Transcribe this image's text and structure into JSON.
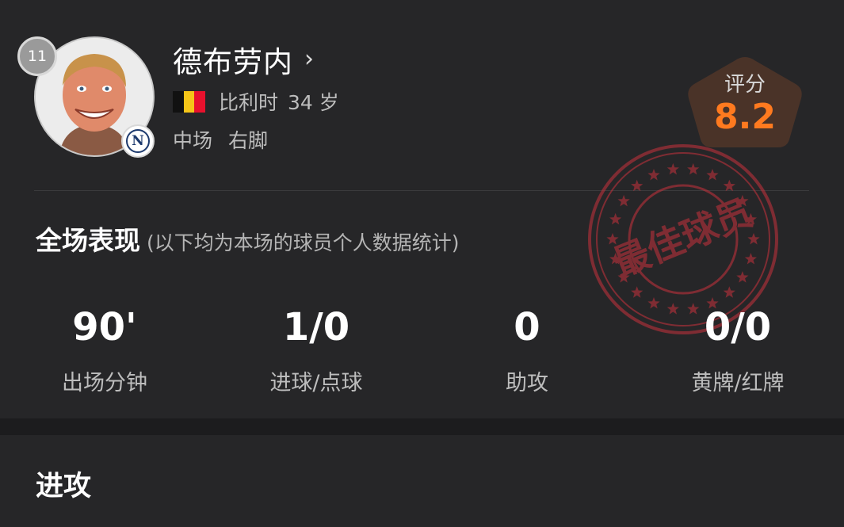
{
  "player": {
    "number": "11",
    "name": "德布劳内",
    "country": "比利时",
    "age": "34 岁",
    "position": "中场",
    "foot": "右脚",
    "club_badge_letter": "N"
  },
  "rating": {
    "label": "评分",
    "value": "8.2",
    "color": "#ff7a1f",
    "badge_color": "#4a3328"
  },
  "performance": {
    "title": "全场表现",
    "note": "(以下均为本场的球员个人数据统计)",
    "stamp_text": "最佳球员",
    "stats": [
      {
        "value": "90'",
        "label": "出场分钟"
      },
      {
        "value": "1/0",
        "label": "进球/点球"
      },
      {
        "value": "0",
        "label": "助攻"
      },
      {
        "value": "0/0",
        "label": "黄牌/红牌"
      }
    ]
  },
  "attack": {
    "title": "进攻"
  },
  "icons": {
    "chevron": "chevron-right-icon",
    "flag": "belgium-flag-icon"
  },
  "colors": {
    "background": "#262628",
    "stamp": "#c8323c",
    "flag": [
      "#111111",
      "#f5c518",
      "#e8112d"
    ]
  }
}
